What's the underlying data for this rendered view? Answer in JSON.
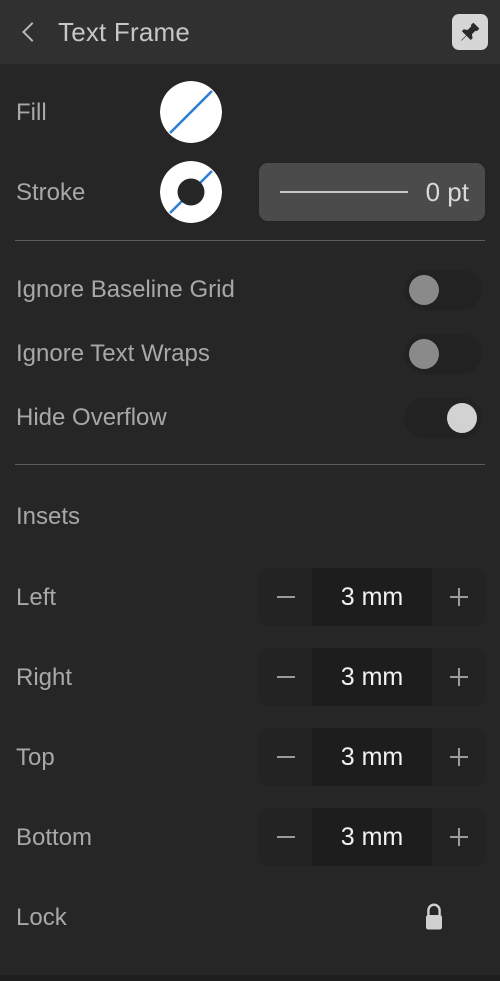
{
  "window": {
    "background_color": "#262626",
    "header_background_color": "#303030",
    "label_color": "#a8a8a8",
    "accent_color": "#2f7fd4"
  },
  "header": {
    "title": "Text Frame",
    "back_icon": "chevron-left-icon",
    "pin_icon": "pushpin-icon",
    "pin_active": true
  },
  "appearance": {
    "fill": {
      "label": "Fill",
      "swatch_type": "none-diagonal-circle",
      "swatch_color": "#ffffff",
      "slash_color": "#2f7fd4"
    },
    "stroke": {
      "label": "Stroke",
      "swatch_type": "none-diagonal-ring",
      "swatch_color": "#ffffff",
      "slash_color": "#2f7fd4",
      "width_value": "0 pt"
    }
  },
  "options": [
    {
      "label": "Ignore Baseline Grid",
      "state": "off"
    },
    {
      "label": "Ignore Text Wraps",
      "state": "off"
    },
    {
      "label": "Hide Overflow",
      "state": "on"
    }
  ],
  "insets": {
    "section_title": "Insets",
    "decrement_label": "−",
    "increment_label": "+",
    "rows": [
      {
        "label": "Left",
        "value": "3 mm"
      },
      {
        "label": "Right",
        "value": "3 mm"
      },
      {
        "label": "Top",
        "value": "3 mm"
      },
      {
        "label": "Bottom",
        "value": "3 mm"
      }
    ]
  },
  "lock": {
    "label": "Lock",
    "icon": "padlock-open-icon",
    "locked": false
  }
}
